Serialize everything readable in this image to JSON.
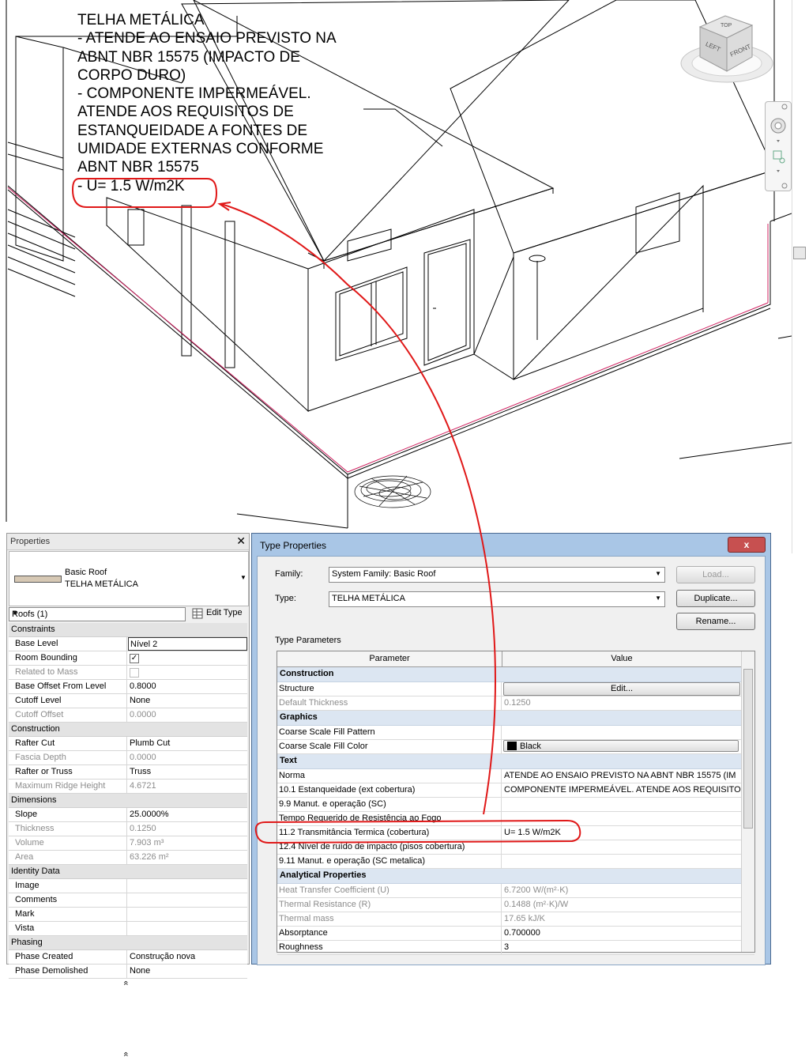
{
  "annotation": {
    "lines": [
      "TELHA METÁLICA",
      "- ATENDE AO ENSAIO PREVISTO NA",
      "ABNT NBR 15575 (IMPACTO DE",
      "CORPO DURO)",
      "- COMPONENTE IMPERMEÁVEL.",
      "ATENDE AOS REQUISITOS DE",
      "ESTANQUEIDADE A FONTES DE",
      "UMIDADE EXTERNAS CONFORME",
      "ABNT NBR 15575",
      "- U= 1.5 W/m2K"
    ]
  },
  "viewcube": {
    "top": "TOP",
    "left": "LEFT",
    "front": "FRONT"
  },
  "properties": {
    "title": "Properties",
    "close": "✕",
    "type_family": "Basic Roof",
    "type_name": "TELHA METÁLICA",
    "instance_filter": "Roofs (1)",
    "edit_type": "Edit Type",
    "groups": [
      {
        "name": "Constraints",
        "rows": [
          {
            "name": "Base Level",
            "value": "Nível 2",
            "ro": false,
            "boxed": true
          },
          {
            "name": "Room Bounding",
            "value": "✓",
            "ro": false,
            "check": true
          },
          {
            "name": "Related to Mass",
            "value": "",
            "ro": true,
            "check": true
          },
          {
            "name": "Base Offset From Level",
            "value": "0.8000",
            "ro": false
          },
          {
            "name": "Cutoff Level",
            "value": "None",
            "ro": false
          },
          {
            "name": "Cutoff Offset",
            "value": "0.0000",
            "ro": true
          }
        ]
      },
      {
        "name": "Construction",
        "rows": [
          {
            "name": "Rafter Cut",
            "value": "Plumb Cut",
            "ro": false
          },
          {
            "name": "Fascia Depth",
            "value": "0.0000",
            "ro": true
          },
          {
            "name": "Rafter or Truss",
            "value": "Truss",
            "ro": false
          },
          {
            "name": "Maximum Ridge Height",
            "value": "4.6721",
            "ro": true
          }
        ]
      },
      {
        "name": "Dimensions",
        "rows": [
          {
            "name": "Slope",
            "value": "25.0000%",
            "ro": false
          },
          {
            "name": "Thickness",
            "value": "0.1250",
            "ro": true
          },
          {
            "name": "Volume",
            "value": "7.903 m³",
            "ro": true
          },
          {
            "name": "Area",
            "value": "63.226 m²",
            "ro": true
          }
        ]
      },
      {
        "name": "Identity Data",
        "rows": [
          {
            "name": "Image",
            "value": "",
            "ro": false
          },
          {
            "name": "Comments",
            "value": "",
            "ro": false
          },
          {
            "name": "Mark",
            "value": "",
            "ro": false
          },
          {
            "name": "Vista",
            "value": "",
            "ro": false
          }
        ]
      },
      {
        "name": "Phasing",
        "rows": [
          {
            "name": "Phase Created",
            "value": "Construção nova",
            "ro": false
          },
          {
            "name": "Phase Demolished",
            "value": "None",
            "ro": false
          }
        ]
      }
    ]
  },
  "type_dialog": {
    "title": "Type Properties",
    "close": "x",
    "family_label": "Family:",
    "family_value": "System Family: Basic Roof",
    "type_label": "Type:",
    "type_value": "TELHA METÁLICA",
    "load": "Load...",
    "duplicate": "Duplicate...",
    "rename": "Rename...",
    "type_parameters": "Type Parameters",
    "col_parameter": "Parameter",
    "col_value": "Value",
    "groups": [
      {
        "name": "Construction",
        "rows": [
          {
            "name": "Structure",
            "value": "Edit...",
            "button": true
          },
          {
            "name": "Default Thickness",
            "value": "0.1250",
            "ro": true
          }
        ]
      },
      {
        "name": "Graphics",
        "rows": [
          {
            "name": "Coarse Scale Fill Pattern",
            "value": ""
          },
          {
            "name": "Coarse Scale Fill Color",
            "value": "Black",
            "swatch": true
          }
        ]
      },
      {
        "name": "Text",
        "rows": [
          {
            "name": "Norma",
            "value": "ATENDE AO ENSAIO PREVISTO NA ABNT NBR 15575 (IM"
          },
          {
            "name": "10.1 Estanqueidade (ext cobertura)",
            "value": "COMPONENTE IMPERMEÁVEL. ATENDE AOS REQUISITO"
          },
          {
            "name": "9.9 Manut. e operação (SC)",
            "value": ""
          },
          {
            "name": "Tempo Requerido de Resistência ao Fogo",
            "value": ""
          },
          {
            "name": "11.2 Transmitância Termica (cobertura)",
            "value": "U= 1.5 W/m2K"
          },
          {
            "name": "12.4 Nível de ruído de impacto (pisos cobertura)",
            "value": ""
          },
          {
            "name": "9.11 Manut. e operação (SC metalica)",
            "value": ""
          }
        ]
      },
      {
        "name": "Analytical Properties",
        "rows": [
          {
            "name": "Heat Transfer Coefficient (U)",
            "value": "6.7200 W/(m²·K)",
            "ro": true
          },
          {
            "name": "Thermal Resistance (R)",
            "value": "0.1488 (m²·K)/W",
            "ro": true
          },
          {
            "name": "Thermal mass",
            "value": "17.65 kJ/K",
            "ro": true
          },
          {
            "name": "Absorptance",
            "value": "0.700000"
          },
          {
            "name": "Roughness",
            "value": "3"
          }
        ]
      }
    ]
  },
  "colors": {
    "highlight": "#e01818",
    "dialog_frame": "#a9c6e6",
    "group_row": "#dce6f2"
  }
}
